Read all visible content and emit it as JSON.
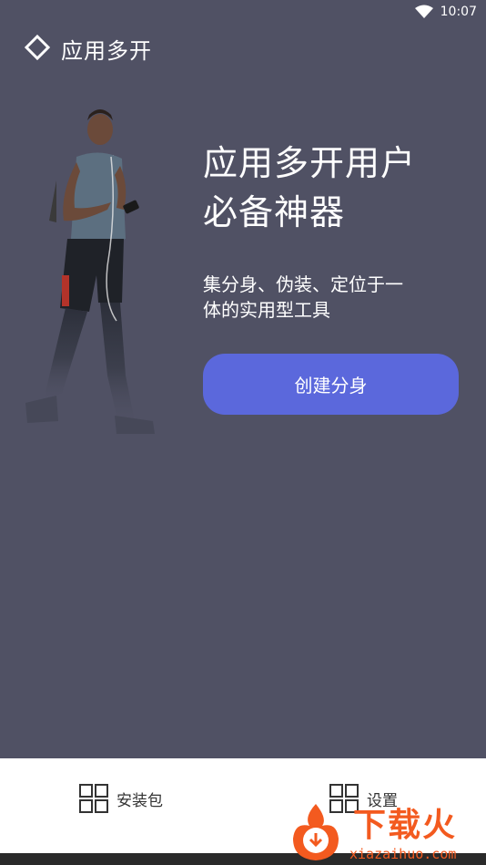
{
  "status_bar": {
    "time": "10:07",
    "wifi_icon": "wifi-icon"
  },
  "header": {
    "title": "应用多开",
    "logo_icon": "diamond-logo-icon"
  },
  "hero": {
    "title_line1": "应用多开用户",
    "title_line2": "必备神器",
    "subtitle_line1": "集分身、伪装、定位于一",
    "subtitle_line2": "体的实用型工具",
    "button_label": "创建分身",
    "button_color": "#5b68dc"
  },
  "bottom_nav": {
    "items": [
      {
        "label": "安装包",
        "icon": "grid-icon"
      },
      {
        "label": "设置",
        "icon": "grid-icon"
      }
    ]
  },
  "watermark": {
    "text": "下载火",
    "url": "xiazaihuo.com"
  },
  "colors": {
    "background": "#505164",
    "accent": "#5b68dc",
    "watermark": "#f35a1f"
  }
}
